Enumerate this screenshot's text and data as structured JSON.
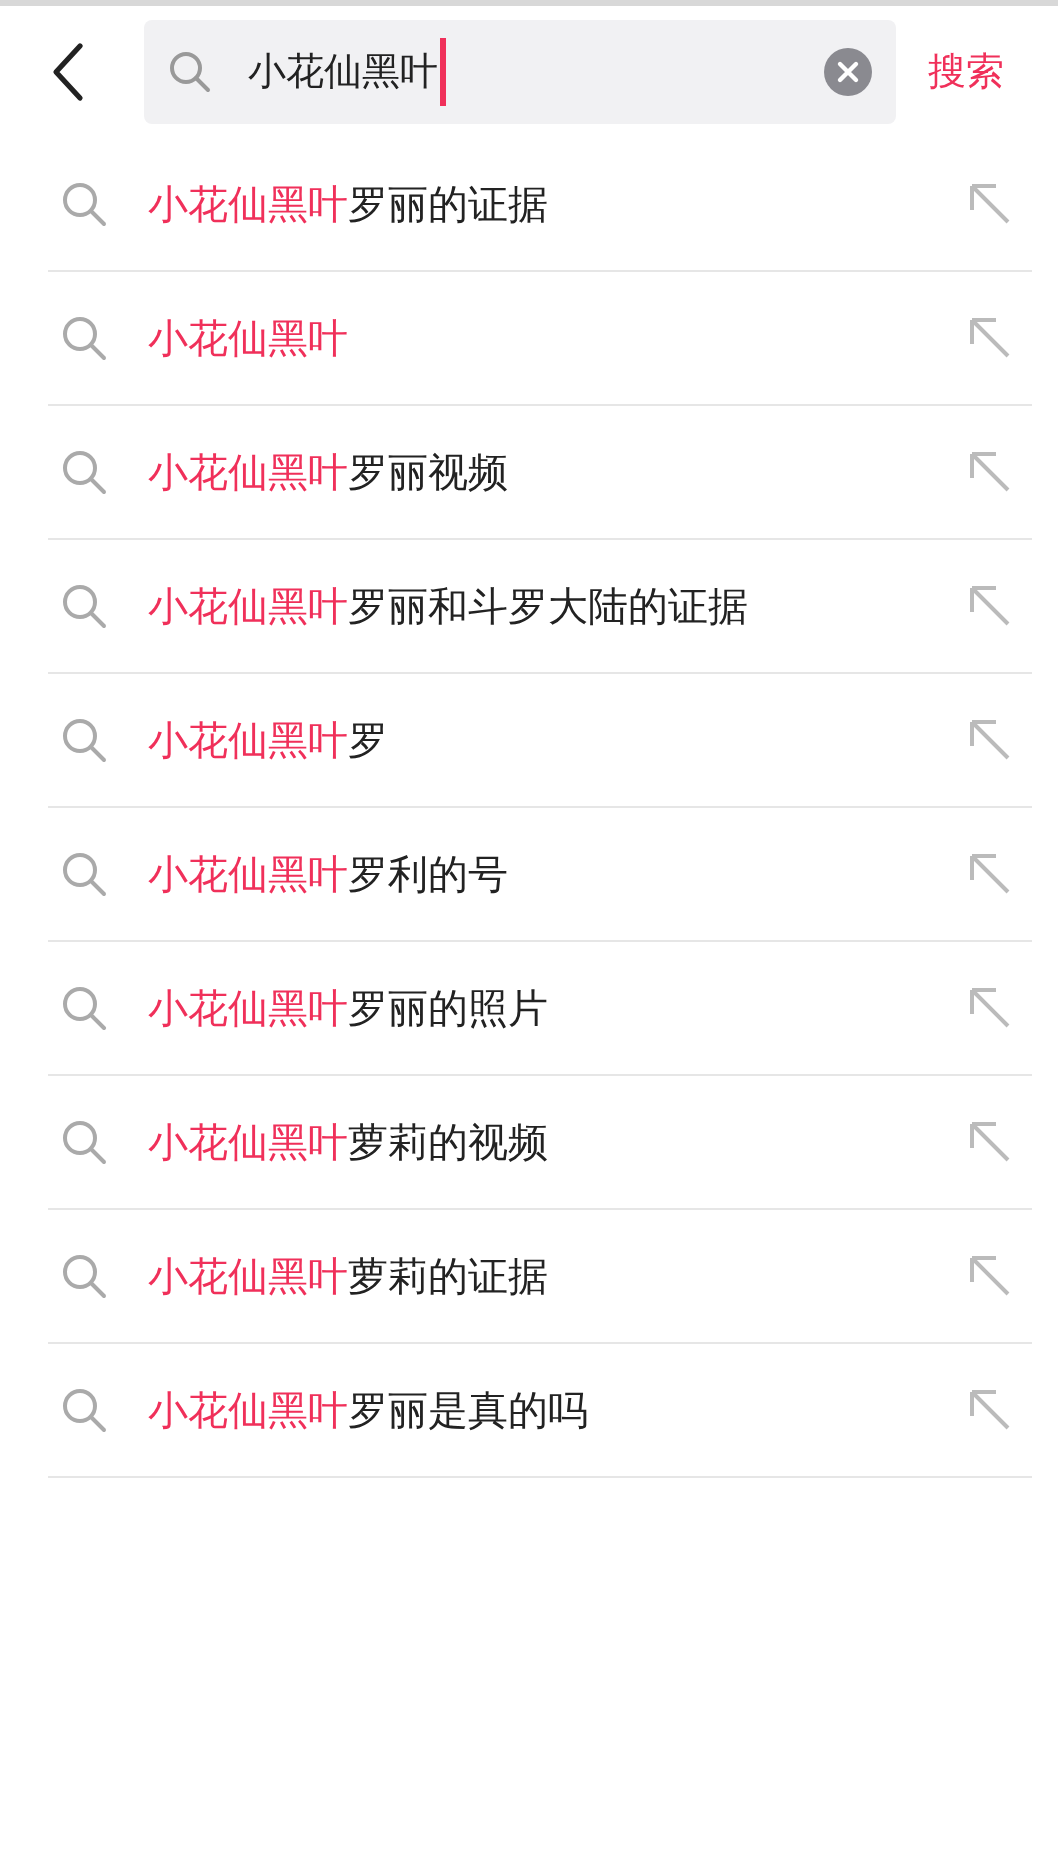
{
  "search_bar": {
    "value": "小花仙黑叶",
    "search_button": "搜索"
  },
  "suggestions": [
    {
      "highlight": "小花仙黑叶",
      "rest": "罗丽的证据"
    },
    {
      "highlight": "小花仙黑叶"
    },
    {
      "highlight": "小花仙黑叶",
      "rest": "罗丽视频"
    },
    {
      "highlight": "小花仙黑叶",
      "rest": "罗丽和斗罗大陆的证据"
    },
    {
      "highlight": "小花仙黑叶",
      "rest": "罗"
    },
    {
      "highlight": "小花仙黑叶",
      "rest": "罗利的号"
    },
    {
      "highlight": "小花仙黑叶",
      "rest": "罗丽的照片"
    },
    {
      "highlight": "小花仙黑叶",
      "rest": "萝莉的视频"
    },
    {
      "highlight": "小花仙黑叶",
      "rest": "萝莉的证据"
    },
    {
      "highlight": "小花仙黑叶",
      "rest": "罗丽是真的吗"
    }
  ]
}
